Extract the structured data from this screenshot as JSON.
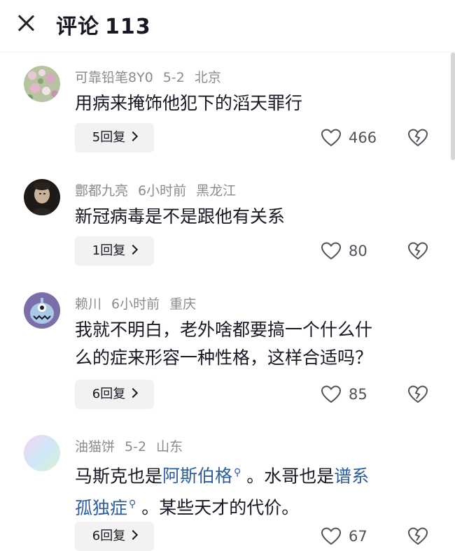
{
  "header": {
    "title": "评论",
    "count": "113"
  },
  "comments": [
    {
      "user": "可靠铅笔8Y0",
      "time": "5-2",
      "location": "北京",
      "text_parts": [
        "用病来掩饰他犯下的滔天罪行"
      ],
      "reply_label": "5回复",
      "likes": "466"
    },
    {
      "user": "鄷都九亮",
      "time": "6小时前",
      "location": "黑龙江",
      "text_parts": [
        "新冠病毒是不是跟他有关系"
      ],
      "reply_label": "1回复",
      "likes": "80"
    },
    {
      "user": "赖川",
      "time": "6小时前",
      "location": "重庆",
      "text_line1": "我就不明白，老外啥都要搞一个什么什",
      "text_line2": "么的症来形容一种性格，这样合适吗？",
      "reply_label": "6回复",
      "likes": "85"
    },
    {
      "user": "油猫饼",
      "time": "5-2",
      "location": "山东",
      "seg1": "马斯克也是",
      "link1": "阿斯伯格",
      "seg2": "。水哥也是",
      "link2a": "谱系",
      "link2b": "孤独症",
      "seg3": "。某些天才的代价。",
      "reply_label": "6回复",
      "likes": "67"
    }
  ],
  "colors": {
    "link": "#2b5d9b",
    "meta": "#8a8b91",
    "text": "#161823",
    "reply_bg": "#f2f2f2"
  },
  "icons": {
    "close": "close-icon",
    "like": "heart-outline-icon",
    "dislike": "broken-heart-icon",
    "search": "search-icon"
  }
}
